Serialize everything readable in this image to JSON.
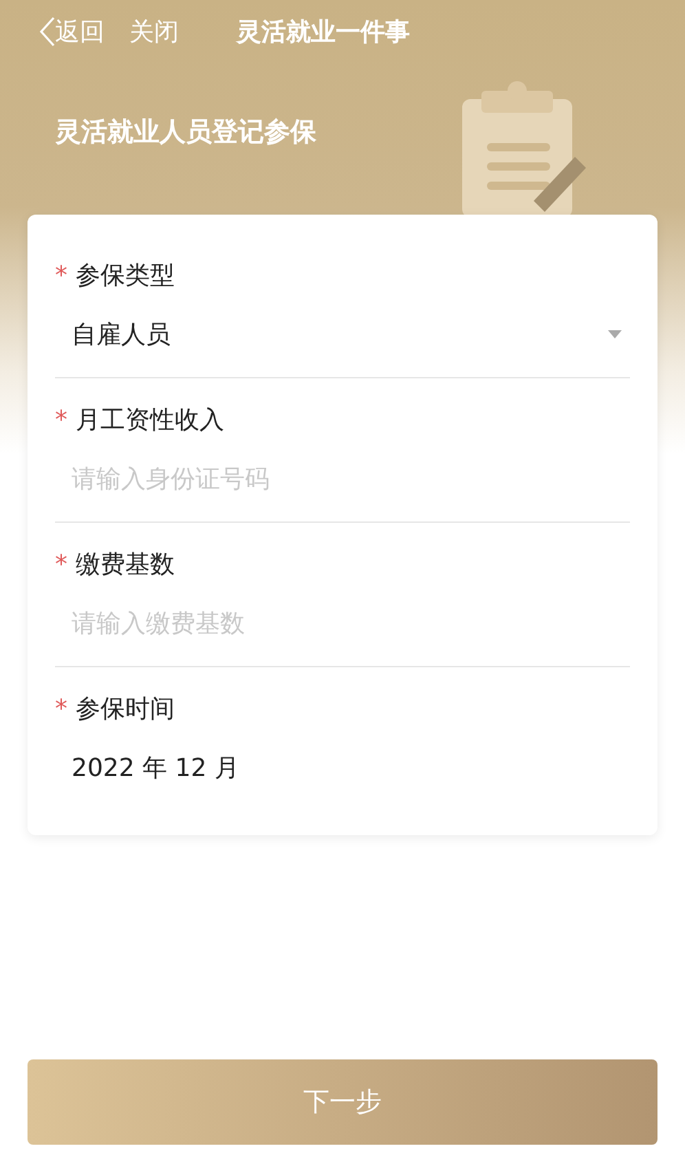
{
  "nav": {
    "back": "返回",
    "close": "关闭",
    "title": "灵活就业一件事"
  },
  "banner": {
    "title": "灵活就业人员登记参保"
  },
  "fields": [
    {
      "kind": "select",
      "mark": "*",
      "label": "参保类型",
      "value": "自雇人员"
    },
    {
      "kind": "input",
      "mark": "*",
      "label": "月工资性收入",
      "placeholder": "请输入身份证号码"
    },
    {
      "kind": "input",
      "mark": "*",
      "label": "缴费基数",
      "placeholder": "请输入缴费基数"
    },
    {
      "kind": "text",
      "mark": "*",
      "label": "参保时间",
      "value": "2022 年 12 月"
    }
  ],
  "next_button": "下一步"
}
